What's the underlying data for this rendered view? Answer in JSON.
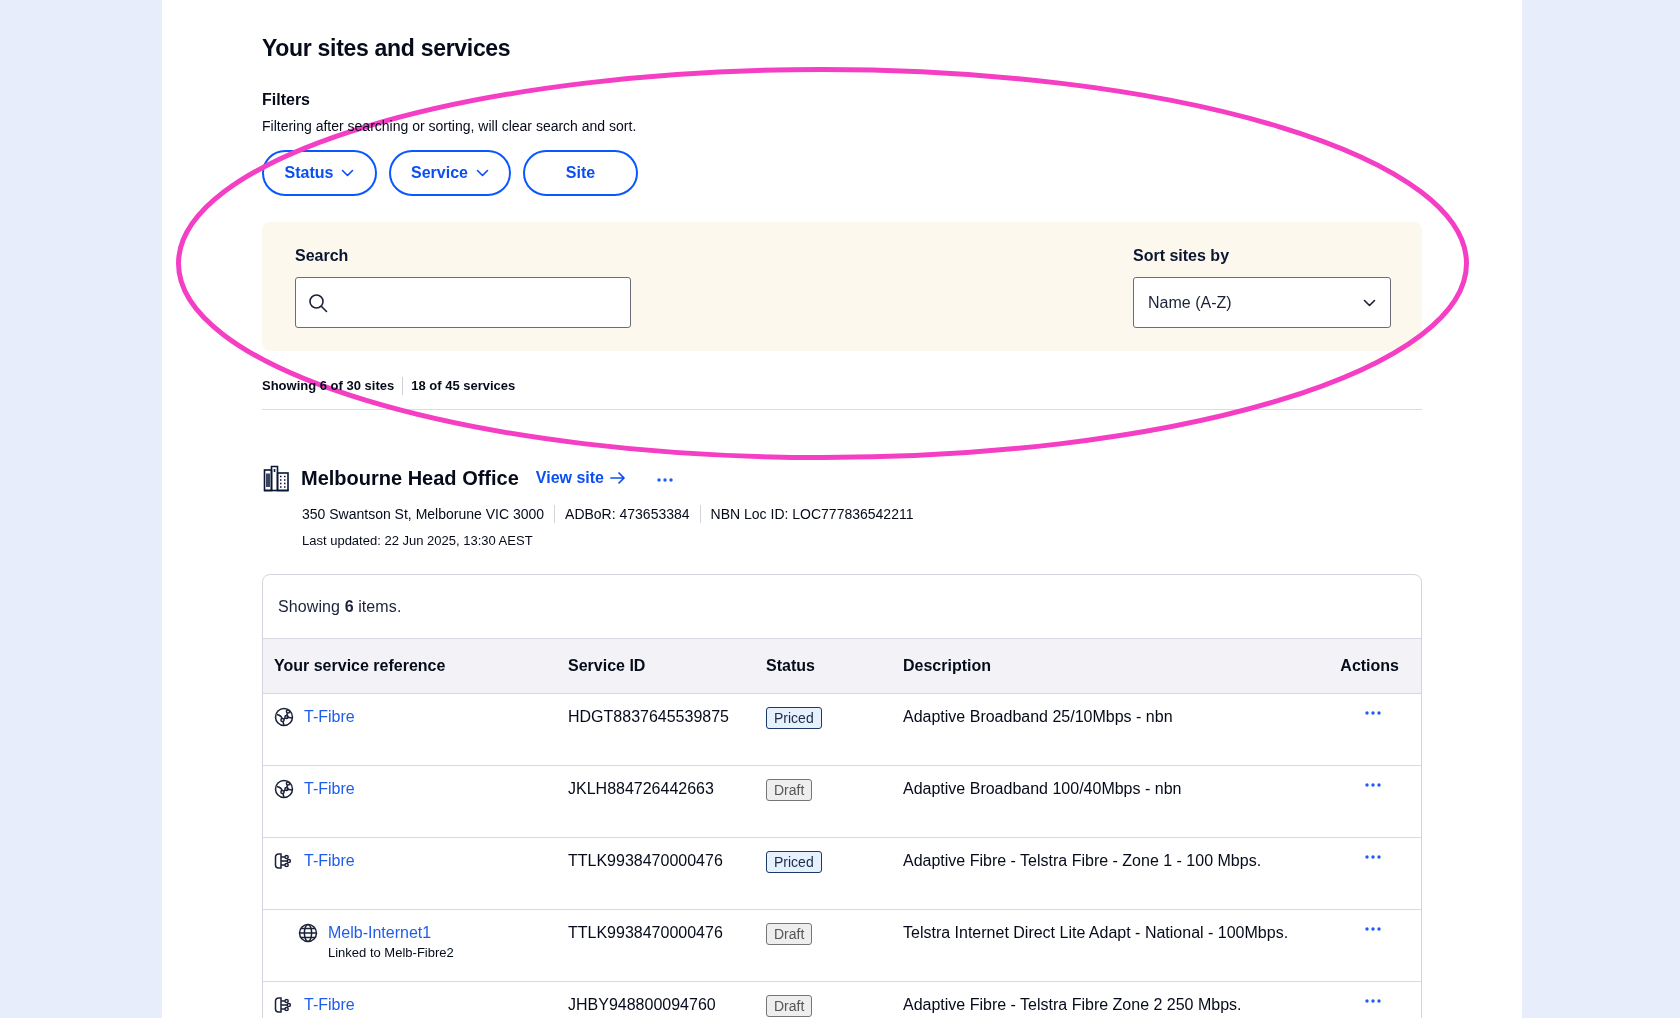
{
  "page": {
    "title": "Your sites and services"
  },
  "filters": {
    "heading": "Filters",
    "note": "Filtering after searching or sorting, will clear search and sort.",
    "buttons": [
      {
        "label": "Status",
        "dropdown": true
      },
      {
        "label": "Service",
        "dropdown": true
      },
      {
        "label": "Site",
        "dropdown": false
      }
    ]
  },
  "search_panel": {
    "search": {
      "label": "Search"
    },
    "sort": {
      "label": "Sort sites by",
      "value": "Name (A-Z)"
    }
  },
  "summary": [
    "Showing 6 of 30 sites",
    "18 of 45 services"
  ],
  "site": {
    "name": "Melbourne Head Office",
    "link": "View site",
    "details": [
      "350 Swantson St, Melborune VIC 3000",
      "ADBoR: 473653384",
      "NBN Loc ID: LOC777836542211"
    ],
    "last_updated": "Last updated: 22 Jun 2025, 13:30 AEST"
  },
  "table": {
    "caption": "Showing **6** items.",
    "columns": [
      "Your service reference",
      "Service ID",
      "Status",
      "Description",
      "Actions"
    ],
    "rows": [
      {
        "kind": "broadband",
        "reference": "T-Fibre",
        "service_id": "HDGT8837645539875",
        "status": {
          "label": "Priced",
          "kind": "priced"
        },
        "description": "Adaptive Broadband 25/10Mbps - nbn"
      },
      {
        "kind": "broadband",
        "reference": "T-Fibre",
        "service_id": "JKLH884726442663",
        "status": {
          "label": "Draft",
          "kind": "draft"
        },
        "description": "Adaptive Broadband 100/40Mbps - nbn"
      },
      {
        "kind": "fibre",
        "reference": "T-Fibre",
        "service_id": "TTLK9938470000476",
        "status": {
          "label": "Priced",
          "kind": "priced"
        },
        "description": "Adaptive Fibre - Telstra Fibre - Zone 1 - 100 Mbps.",
        "children": [
          {
            "kind": "internet",
            "reference": "Melb-Internet1",
            "note": "Linked to Melb-Fibre2",
            "service_id": "TTLK9938470000476",
            "status": {
              "label": "Draft",
              "kind": "draft"
            },
            "description": "Telstra Internet Direct Lite Adapt - National - 100Mbps."
          }
        ]
      },
      {
        "kind": "fibre",
        "reference": "T-Fibre",
        "service_id": "JHBY948800094760",
        "status": {
          "label": "Draft",
          "kind": "draft"
        },
        "description": "Adaptive Fibre - Telstra Fibre Zone 2 250 Mbps."
      }
    ]
  }
}
